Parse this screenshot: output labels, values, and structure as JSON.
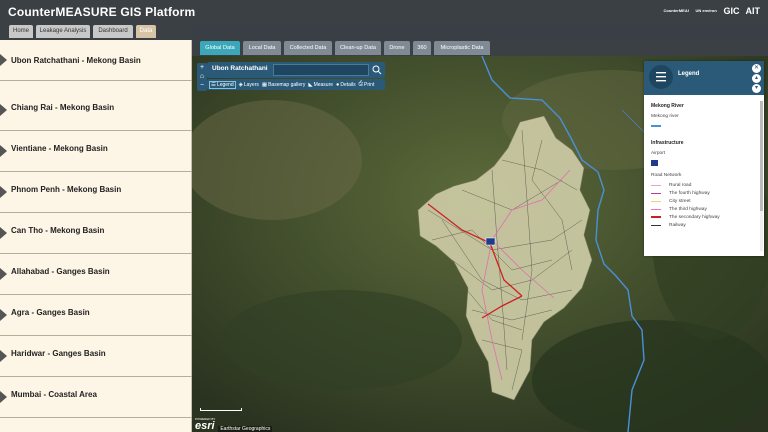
{
  "header": {
    "title": "CounterMEASURE GIS Platform",
    "logos": [
      "CounterMEASURE",
      "UN environment programme",
      "GIC",
      "AIT"
    ]
  },
  "main_tabs": [
    {
      "label": "Home",
      "active": false
    },
    {
      "label": "Leakage Analysis",
      "active": false
    },
    {
      "label": "Dashboard",
      "active": false
    },
    {
      "label": "Data",
      "active": true
    }
  ],
  "sidebar": {
    "items": [
      {
        "label": "Ubon Ratchathani - Mekong Basin"
      },
      {
        "label": "Chiang Rai - Mekong Basin"
      },
      {
        "label": "Vientiane - Mekong Basin"
      },
      {
        "label": "Phnom Penh - Mekong Basin"
      },
      {
        "label": "Can Tho - Mekong Basin"
      },
      {
        "label": "Allahabad - Ganges Basin"
      },
      {
        "label": "Agra - Ganges Basin"
      },
      {
        "label": "Haridwar - Ganges Basin"
      },
      {
        "label": "Mumbai - Coastal Area"
      }
    ]
  },
  "data_tabs": [
    {
      "label": "Global Data",
      "active": true
    },
    {
      "label": "Local Data",
      "active": false
    },
    {
      "label": "Collected Data",
      "active": false
    },
    {
      "label": "Clean-up Data",
      "active": false
    },
    {
      "label": "Drone",
      "active": false
    },
    {
      "label": "360",
      "active": false
    },
    {
      "label": "Microplastic Data",
      "active": false
    }
  ],
  "map": {
    "search_title": "Ubon Ratchathani",
    "search_value": "",
    "toolbar": [
      "Legend",
      "Layers",
      "Basemap gallery",
      "Measure",
      "Details",
      "Print"
    ],
    "attribution": "Earthstar Geographics",
    "esri": "esri",
    "powered_by": "POWERED BY"
  },
  "legend": {
    "title": "Legend",
    "sections": [
      {
        "title": "Mekong River",
        "sub": "Mekong river",
        "rows": [
          {
            "label": "",
            "color": "#4a90d9"
          }
        ]
      },
      {
        "title": "Infrastructure",
        "sub": "Airport",
        "rows": []
      }
    ],
    "road_title": "Road Network",
    "roads": [
      {
        "label": "Rural road",
        "color": "#e8a0c8"
      },
      {
        "label": "The fourth highway",
        "color": "#b04090"
      },
      {
        "label": "City street",
        "color": "#f0d070"
      },
      {
        "label": "The third highway",
        "color": "#e07ab0"
      },
      {
        "label": "The secondary highway",
        "color": "#c82020"
      },
      {
        "label": "Railway",
        "color": "#333333"
      }
    ]
  },
  "colors": {
    "header_bg": "#3b4045",
    "accent": "#3aa8b8",
    "sidebar_bg": "#fdf5e6",
    "panel": "#2b5a78",
    "region_fill": "#c8c8a0"
  }
}
